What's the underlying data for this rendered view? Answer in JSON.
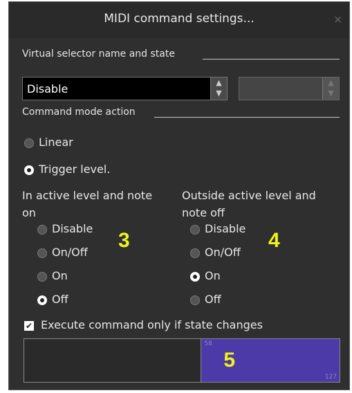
{
  "window": {
    "title": "MIDI command settings...",
    "close_glyph": "×"
  },
  "selector": {
    "label": "Virtual selector name and state",
    "combo_value": "Disable",
    "spin_up": "▲",
    "spin_down": "▼"
  },
  "command_mode": {
    "label": "Command mode action",
    "options": [
      {
        "label": "Linear",
        "selected": false
      },
      {
        "label": "Trigger level.",
        "selected": true
      }
    ]
  },
  "active_group": {
    "header_line1": "In active level and note",
    "header_line2": "on",
    "options": [
      {
        "label": "Disable",
        "selected": false
      },
      {
        "label": "On/Off",
        "selected": false
      },
      {
        "label": "On",
        "selected": false
      },
      {
        "label": "Off",
        "selected": true
      }
    ],
    "marker": "3"
  },
  "outside_group": {
    "header_line1": "Outside active level and",
    "header_line2": "note off",
    "options": [
      {
        "label": "Disable",
        "selected": false
      },
      {
        "label": "On/Off",
        "selected": false
      },
      {
        "label": "On",
        "selected": true
      },
      {
        "label": "Off",
        "selected": false
      }
    ],
    "marker": "4"
  },
  "execute_checkbox": {
    "label": "Execute command only if state changes",
    "checked": true,
    "check_glyph": "✔"
  },
  "level_panel": {
    "marker": "5",
    "min_label": "58",
    "max_label": "127",
    "active_fraction": 0.44,
    "colors": {
      "active": "#4b3aa8",
      "inactive": "#2a2a2a"
    }
  }
}
